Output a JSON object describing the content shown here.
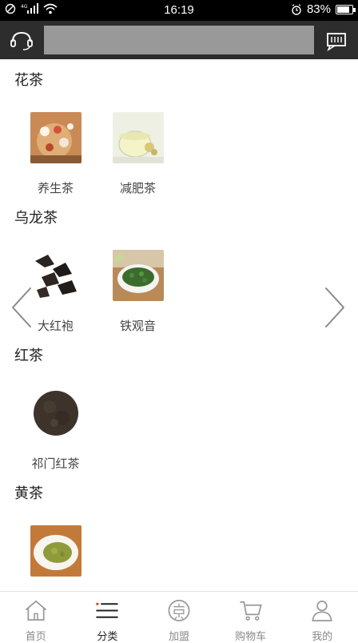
{
  "status_bar": {
    "time": "16:19",
    "battery": "83%",
    "battery_level": 0.83,
    "network": "4G"
  },
  "header": {
    "search_value": "",
    "search_placeholder": ""
  },
  "sections": [
    {
      "title": "花茶",
      "items": [
        {
          "label": "养生茶",
          "image": "flower-tea-photo"
        },
        {
          "label": "减肥茶",
          "image": "slimming-tea-photo"
        }
      ]
    },
    {
      "title": "乌龙茶",
      "items": [
        {
          "label": "大红袍",
          "image": "dahongpao-leaves-photo"
        },
        {
          "label": "铁观音",
          "image": "tieguanyin-bowl-photo"
        }
      ]
    },
    {
      "title": "红茶",
      "items": [
        {
          "label": "祁门红茶",
          "image": "keemun-black-tea-photo"
        }
      ]
    },
    {
      "title": "黄茶",
      "items": [
        {
          "label": "",
          "image": "yellow-tea-plate-photo"
        }
      ]
    }
  ],
  "tabbar": {
    "items": [
      {
        "label": "首页",
        "icon": "home-icon",
        "active": false
      },
      {
        "label": "分类",
        "icon": "category-icon",
        "active": true
      },
      {
        "label": "加盟",
        "icon": "join-icon",
        "active": false
      },
      {
        "label": "购物车",
        "icon": "cart-icon",
        "active": false
      },
      {
        "label": "我的",
        "icon": "user-icon",
        "active": false
      }
    ]
  },
  "colors": {
    "header_bg": "#2d2d2d",
    "search_bg": "#999999",
    "status_bg": "#000000",
    "tab_inactive": "#888888",
    "tab_active": "#222222"
  }
}
